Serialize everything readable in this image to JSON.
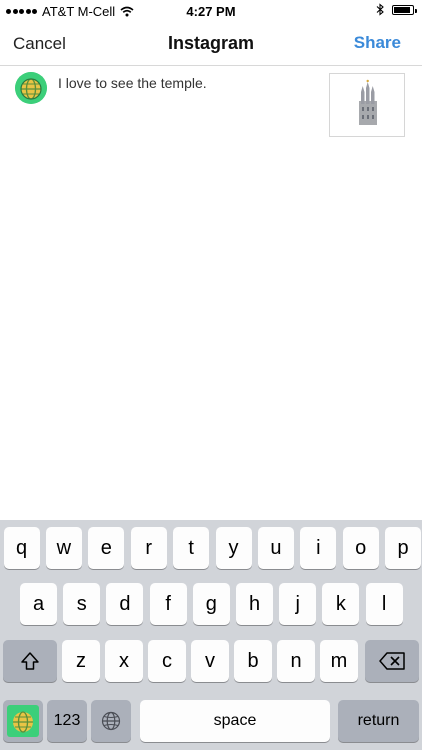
{
  "status_bar": {
    "carrier": "AT&T M-Cell",
    "time": "4:27 PM",
    "battery_level": 0.9
  },
  "nav": {
    "cancel_label": "Cancel",
    "title": "Instagram",
    "share_label": "Share"
  },
  "post": {
    "caption": "I love to see the temple."
  },
  "keyboard": {
    "row1": [
      "q",
      "w",
      "e",
      "r",
      "t",
      "y",
      "u",
      "i",
      "o",
      "p"
    ],
    "row2": [
      "a",
      "s",
      "d",
      "f",
      "g",
      "h",
      "j",
      "k",
      "l"
    ],
    "row3": [
      "z",
      "x",
      "c",
      "v",
      "b",
      "n",
      "m"
    ],
    "numbers_label": "123",
    "space_label": "space",
    "return_label": "return"
  },
  "icons": [
    "signal-dots-icon",
    "wifi-icon",
    "bluetooth-icon",
    "battery-icon",
    "shift-icon",
    "backspace-icon",
    "globe-icon",
    "emoji-app-icon"
  ],
  "colors": {
    "accent": "#3b8ad9",
    "keyboard_bg": "#d1d4d9",
    "dark_key": "#abb0ba"
  }
}
